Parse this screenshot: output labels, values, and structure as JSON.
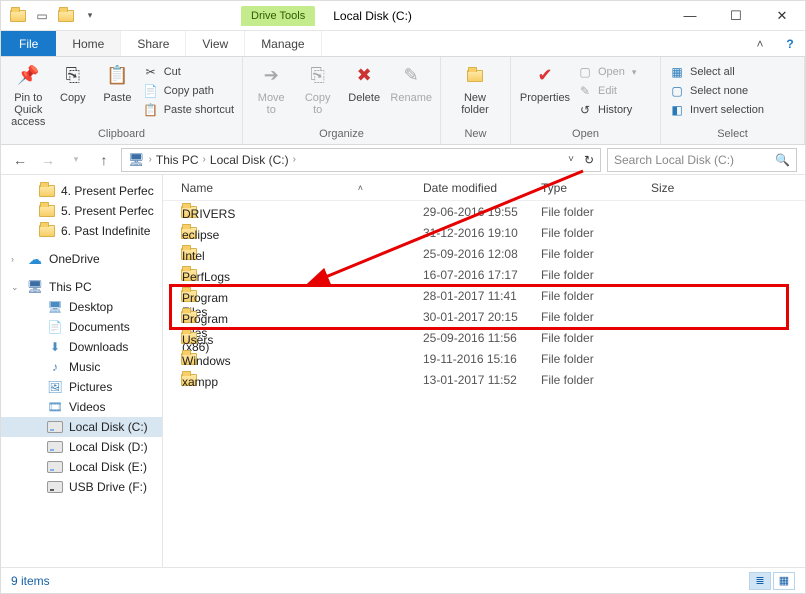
{
  "window": {
    "title": "Local Disk (C:)",
    "drive_tools_label": "Drive Tools"
  },
  "tabs": {
    "file": "File",
    "home": "Home",
    "share": "Share",
    "view": "View",
    "manage": "Manage"
  },
  "ribbon": {
    "clipboard": {
      "label": "Clipboard",
      "pin": "Pin to Quick\naccess",
      "copy": "Copy",
      "paste": "Paste",
      "cut": "Cut",
      "copy_path": "Copy path",
      "paste_shortcut": "Paste shortcut"
    },
    "organize": {
      "label": "Organize",
      "move_to": "Move\nto",
      "copy_to": "Copy\nto",
      "delete": "Delete",
      "rename": "Rename"
    },
    "new": {
      "label": "New",
      "new_folder": "New\nfolder"
    },
    "open": {
      "label": "Open",
      "properties": "Properties",
      "open": "Open",
      "edit": "Edit",
      "history": "History"
    },
    "select": {
      "label": "Select",
      "select_all": "Select all",
      "select_none": "Select none",
      "invert": "Invert selection"
    }
  },
  "breadcrumb": {
    "this_pc": "This PC",
    "drive": "Local Disk (C:)"
  },
  "search": {
    "placeholder": "Search Local Disk (C:)"
  },
  "nav": {
    "quick": [
      "4. Present Perfec",
      "5. Present Perfec",
      "6. Past Indefinite"
    ],
    "onedrive": "OneDrive",
    "this_pc": "This PC",
    "pc_children": [
      {
        "label": "Desktop",
        "kind": "desktop"
      },
      {
        "label": "Documents",
        "kind": "documents"
      },
      {
        "label": "Downloads",
        "kind": "downloads"
      },
      {
        "label": "Music",
        "kind": "music"
      },
      {
        "label": "Pictures",
        "kind": "pictures"
      },
      {
        "label": "Videos",
        "kind": "videos"
      },
      {
        "label": "Local Disk (C:)",
        "kind": "disk",
        "selected": true
      },
      {
        "label": "Local Disk (D:)",
        "kind": "disk"
      },
      {
        "label": "Local Disk (E:)",
        "kind": "disk"
      },
      {
        "label": "USB Drive (F:)",
        "kind": "usb"
      }
    ]
  },
  "columns": {
    "name": "Name",
    "date": "Date modified",
    "type": "Type",
    "size": "Size"
  },
  "rows": [
    {
      "name": "DRIVERS",
      "date": "29-06-2016 19:55",
      "type": "File folder"
    },
    {
      "name": "eclipse",
      "date": "31-12-2016 19:10",
      "type": "File folder"
    },
    {
      "name": "Intel",
      "date": "25-09-2016 12:08",
      "type": "File folder"
    },
    {
      "name": "PerfLogs",
      "date": "16-07-2016 17:17",
      "type": "File folder"
    },
    {
      "name": "Program Files",
      "date": "28-01-2017 11:41",
      "type": "File folder"
    },
    {
      "name": "Program Files (x86)",
      "date": "30-01-2017 20:15",
      "type": "File folder"
    },
    {
      "name": "Users",
      "date": "25-09-2016 11:56",
      "type": "File folder"
    },
    {
      "name": "Windows",
      "date": "19-11-2016 15:16",
      "type": "File folder"
    },
    {
      "name": "xampp",
      "date": "13-01-2017 11:52",
      "type": "File folder"
    }
  ],
  "status": {
    "items": "9 items"
  },
  "annotation": {
    "highlighted_rows": [
      4,
      5
    ]
  }
}
